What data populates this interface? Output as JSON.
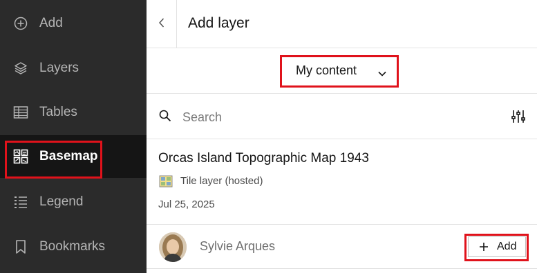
{
  "sidebar": {
    "items": [
      {
        "label": "Add",
        "icon": "add-circle-icon",
        "active": false
      },
      {
        "label": "Layers",
        "icon": "layers-icon",
        "active": false
      },
      {
        "label": "Tables",
        "icon": "table-icon",
        "active": false
      },
      {
        "label": "Basemap",
        "icon": "basemap-icon",
        "active": true
      },
      {
        "label": "Legend",
        "icon": "legend-icon",
        "active": false
      },
      {
        "label": "Bookmarks",
        "icon": "bookmark-icon",
        "active": false
      }
    ]
  },
  "panel": {
    "title": "Add layer",
    "back_icon": "chevron-left-icon",
    "source_dropdown": {
      "selected": "My content"
    },
    "search": {
      "placeholder": "Search",
      "value": ""
    },
    "filter_icon": "filter-sliders-icon",
    "results": [
      {
        "title": "Orcas Island Topographic Map 1943",
        "type": "Tile layer (hosted)",
        "date": "Jul 25, 2025",
        "owner": "Sylvie Arques",
        "add_label": "Add"
      }
    ]
  },
  "colors": {
    "sidebar_bg": "#2b2b2b",
    "sidebar_active_bg": "#151515",
    "highlight": "#e0121b",
    "divider": "#e3e3e3"
  }
}
